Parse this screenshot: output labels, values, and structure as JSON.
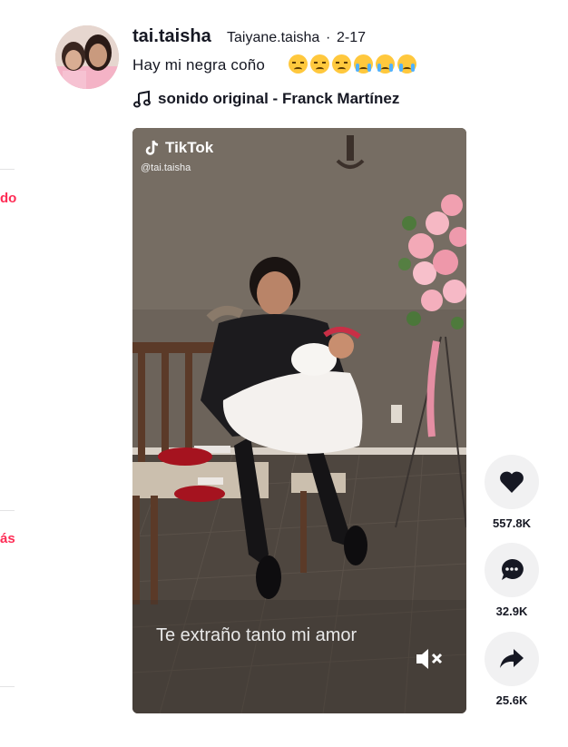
{
  "post": {
    "username": "tai.taisha",
    "nickname": "Taiyane.taisha",
    "separator": "·",
    "date": "2-17",
    "caption": "Hay mi negra coño",
    "emojis": [
      "downcast-sweat-emoji",
      "downcast-sweat-emoji",
      "downcast-sweat-emoji",
      "loudly-crying-emoji",
      "loudly-crying-emoji",
      "loudly-crying-emoji"
    ],
    "music": "sonido original - Franck Martínez"
  },
  "video": {
    "watermark": "TikTok",
    "handle": "@tai.taisha",
    "subtitle": "Te extraño tanto mi amor"
  },
  "actions": {
    "likes": "557.8K",
    "comments": "32.9K",
    "shares": "25.6K"
  },
  "sidebar": {
    "link_top": "do",
    "link_bottom": "ás"
  },
  "colors": {
    "accent": "#fe2c55",
    "text": "#161823",
    "action_bg": "#f1f1f2"
  }
}
